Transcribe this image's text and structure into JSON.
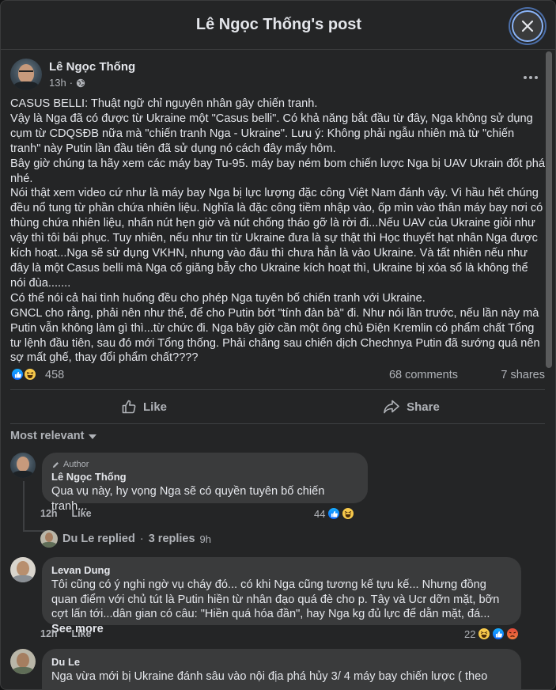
{
  "modal": {
    "title": "Lê Ngọc Thống's post",
    "close_icon": "close-icon"
  },
  "post": {
    "author": "Lê Ngọc Thống",
    "time": "13h",
    "separator": "·",
    "audience_icon": "globe-icon",
    "more_icon": "more-options-icon",
    "body": [
      "CASUS BELLI: Thuật ngữ chỉ nguyên nhân gây chiến tranh.",
      "Vậy là Nga đã có được từ Ukraine một \"Casus belli\". Có khả năng bắt đầu từ đây, Nga không sử dụng cụm từ CDQSĐB nữa mà \"chiến tranh Nga - Ukraine\". Lưu ý: Không phải ngẫu nhiên mà từ \"chiến tranh\" này Putin lần đầu tiên đã sử dụng nó cách đây mấy hôm.",
      "Bây giờ chúng ta hãy xem các máy bay Tu-95. máy bay ném bom chiến lược Nga bị UAV Ukrain đốt phá nhé.",
      "Nói thật xem video cứ như là máy bay Nga bị lực lượng đặc công Việt Nam đánh vậy. Vì hầu hết chúng đều nổ tung từ phần chứa nhiên liệu. Nghĩa là đặc công tiềm nhập vào, ốp mìn vào thân máy bay nơi có thùng chứa nhiên liệu, nhấn nút hẹn giờ và nút chống tháo gỡ là rời đi...Nếu UAV của Ukraine giỏi như vậy thì tôi bái phục. Tuy nhiên, nếu như tin từ Ukraine đưa là sự thật thì Học thuyết hạt nhân Nga được kích hoạt...Nga sẽ sử dụng VKHN, nhưng vào đâu thì chưa hẳn là vào Ukraine. Và tất nhiên nếu như đây là một Casus belli mà Nga cố giăng bẫy cho Ukraine kích hoạt thì, Ukraine bị xóa sổ là không thể nói đùa.......",
      "Có thể nói cả hai tình huống đều cho phép Nga tuyên bố chiến tranh với Ukraine.",
      "GNCL cho rằng, phải nên như thế, để cho Putin bớt \"tính đàn bà\" đi. Như nói lần trước, nếu lần này mà Putin vẫn không làm gì thì...từ chức đi. Nga bây giờ cần một ông chủ Điện Kremlin có phẩm chất Tổng tư lệnh đầu tiên, sau đó mới Tổng thống. Phải chăng sau chiến dịch Chechnya Putin đã sướng quá nên sợ mất ghế, thay đổi phẩm chất????"
    ],
    "reaction_count": "458",
    "comments_count": "68 comments",
    "shares_count": "7 shares",
    "like_label": "Like",
    "share_label": "Share"
  },
  "sort": {
    "label": "Most relevant"
  },
  "comments": [
    {
      "author_badge": "Author",
      "name": "Lê Ngọc Thống",
      "text": "Qua vụ này, hy vọng Nga sẽ có quyền tuyên bố chiến tranh...",
      "time": "12h",
      "like": "Like",
      "reaction_count": "44",
      "replies": {
        "name": "Du Le replied",
        "sep": "·",
        "count": "3 replies",
        "time": "9h"
      }
    },
    {
      "name": "Levan Dung",
      "text": "Tôi cũng có ý nghi ngờ vụ cháy đó... có khi Nga cũng tương kế tựu kế... Nhưng đồng quan điểm với chủ tút là Putin hiền từ nhân đạo quá đè cho p. Tây và Ucr dỡn mặt, bỡn cợt lấn tới...dân gian có câu: \"Hiền quá hóa đần\", hay Nga kg đủ lực để dằn mặt, đá...",
      "see_more": "See more",
      "time": "12h",
      "like": "Like",
      "reaction_count": "22"
    },
    {
      "name": "Du Le",
      "text": "Nga vừa mới bị Ukraine đánh sâu vào nội địa phá hủy 3/ 4 máy bay chiến lược ( theo"
    }
  ],
  "colors": {
    "surface": "#242526",
    "bubble": "#3a3b3c",
    "text_primary": "#e4e6eb",
    "text_secondary": "#b0b3b8",
    "like_blue": "#0866ff"
  }
}
